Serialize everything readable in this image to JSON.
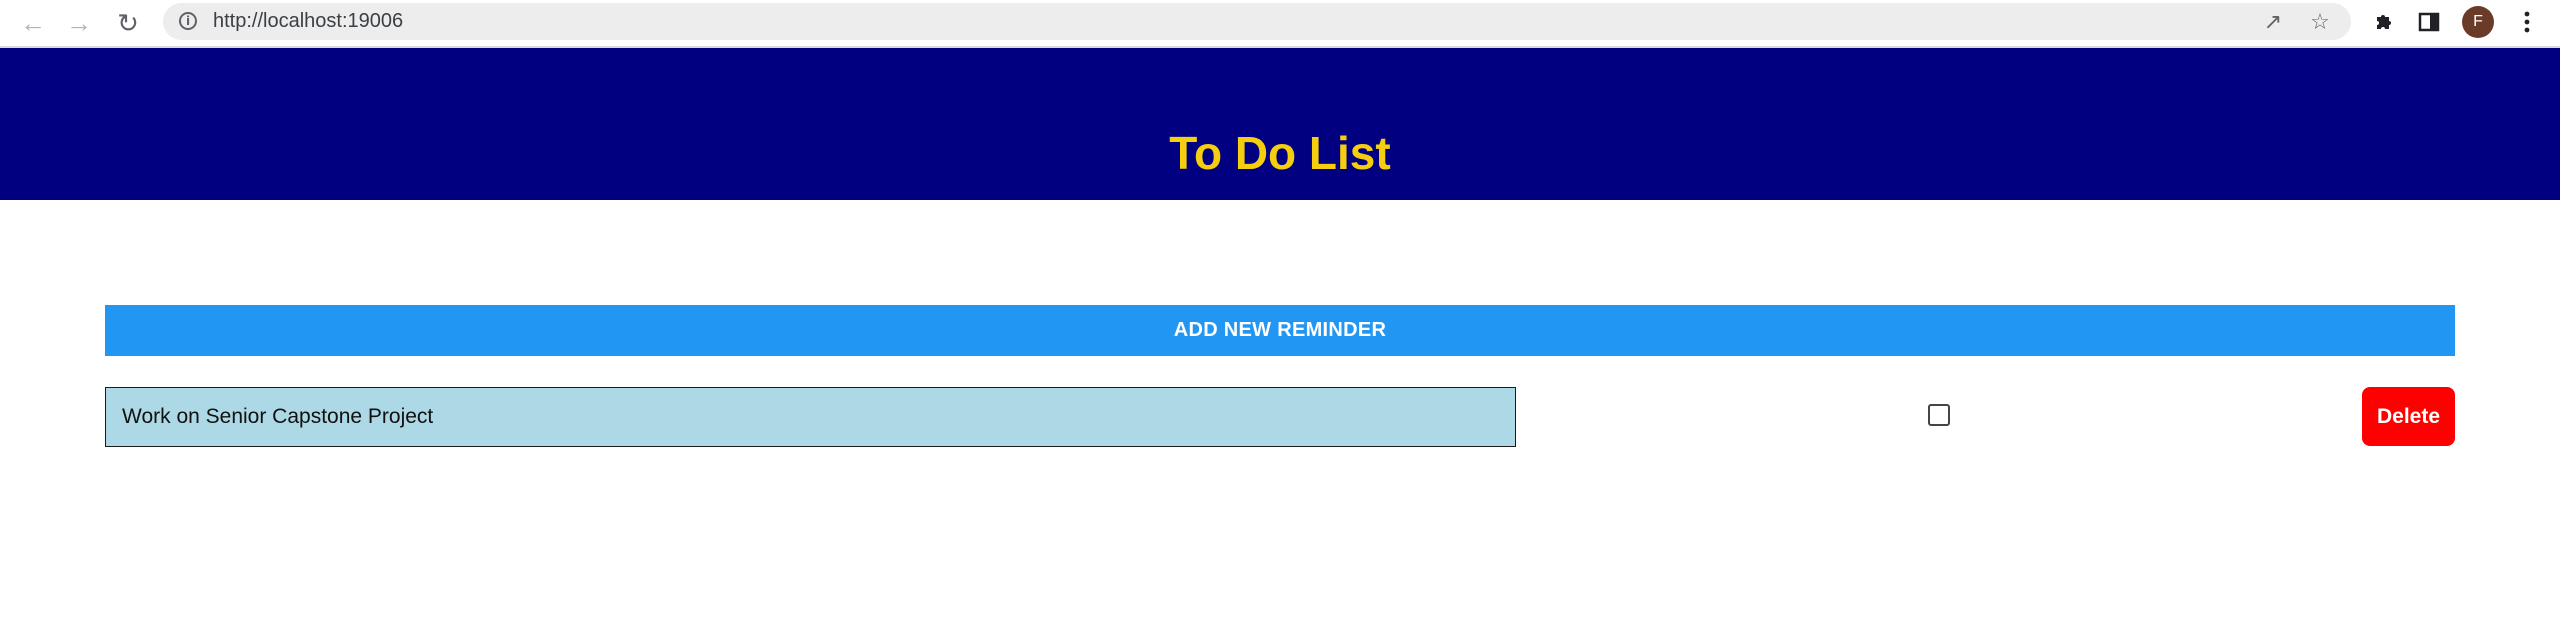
{
  "browser": {
    "url": "http://localhost:19006",
    "profile_initial": "F",
    "icons": {
      "back": "arrow-left-icon",
      "forward": "arrow-right-icon",
      "reload": "reload-icon",
      "site_info": "info-icon",
      "share": "share-icon",
      "bookmark": "star-icon",
      "extensions": "puzzle-icon",
      "side_panel": "side-panel-icon",
      "menu": "kebab-menu-icon"
    }
  },
  "app": {
    "title": "To Do List",
    "add_button_label": "ADD NEW REMINDER",
    "reminders": [
      {
        "text": "Work on Senior Capstone Project",
        "completed": false,
        "delete_label": "Delete"
      }
    ],
    "colors": {
      "header_bg": "#000080",
      "title": "#f5cf0f",
      "add_button": "#2196f3",
      "reminder_bg": "#add8e6",
      "delete_button": "#ff0000"
    }
  }
}
